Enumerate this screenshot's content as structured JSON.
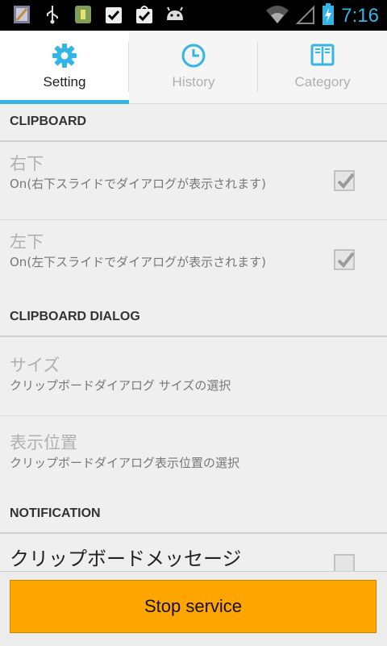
{
  "status_bar": {
    "time": "7:16",
    "icons": [
      "notes-icon",
      "usb-icon",
      "app-icon",
      "task-check-icon",
      "bag-check-icon",
      "android-icon"
    ],
    "right_icons": [
      "wifi-icon",
      "signal-icon",
      "battery-charging-icon"
    ]
  },
  "tabs": [
    {
      "label": "Setting",
      "icon": "gear-icon",
      "active": true
    },
    {
      "label": "History",
      "icon": "clock-icon",
      "active": false
    },
    {
      "label": "Category",
      "icon": "book-icon",
      "active": false
    }
  ],
  "sections": {
    "clipboard": "CLIPBOARD",
    "clipboard_dialog": "CLIPBOARD DIALOG",
    "notification": "NOTIFICATION"
  },
  "items": {
    "bottom_right": {
      "title": "右下",
      "summary": "On(右下スライドでダイアログが表示されます)",
      "checked": true
    },
    "bottom_left": {
      "title": "左下",
      "summary": "On(左下スライドでダイアログが表示されます)",
      "checked": true
    },
    "size": {
      "title": "サイズ",
      "summary": "クリップボードダイアログ サイズの選択"
    },
    "position": {
      "title": "表示位置",
      "summary": "クリップボードダイアログ表示位置の選択"
    },
    "clipboard_message": {
      "title": "クリップボードメッセージ"
    }
  },
  "bottom": {
    "stop_label": "Stop service"
  },
  "colors": {
    "accent": "#33b5e5",
    "button": "#ffa500"
  }
}
